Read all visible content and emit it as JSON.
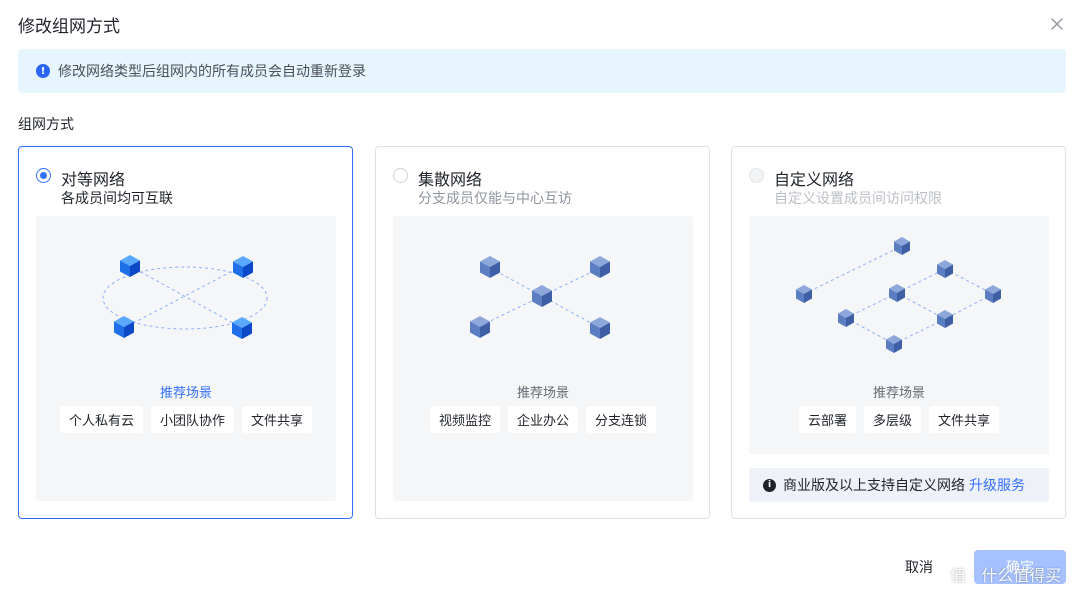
{
  "dialog": {
    "title": "修改组网方式"
  },
  "alert": {
    "text": "修改网络类型后组网内的所有成员会自动重新登录"
  },
  "section": {
    "label": "组网方式"
  },
  "cards": [
    {
      "title": "对等网络",
      "subtitle": "各成员间均可互联",
      "selected": true,
      "scene_label": "推荐场景",
      "tags": [
        "个人私有云",
        "小团队协作",
        "文件共享"
      ]
    },
    {
      "title": "集散网络",
      "subtitle": "分支成员仅能与中心互访",
      "selected": false,
      "scene_label": "推荐场景",
      "tags": [
        "视频监控",
        "企业办公",
        "分支连锁"
      ]
    },
    {
      "title": "自定义网络",
      "subtitle": "自定义设置成员间访问权限",
      "selected": false,
      "disabled": true,
      "scene_label": "推荐场景",
      "tags": [
        "云部署",
        "多层级",
        "文件共享"
      ],
      "notice": {
        "text": "商业版及以上支持自定义网络",
        "link": "升级服务"
      }
    }
  ],
  "footer": {
    "cancel_label": "取消",
    "confirm_label": "确定"
  },
  "watermark": "值 · 什么值得买",
  "colors": {
    "primary": "#3370ff",
    "alert_bg": "#e7f5fe",
    "panel_bg": "#f5f6f8",
    "confirm_disabled": "#a6c1ff",
    "node_bright": "#1e6cf5",
    "node_muted": "#5b7fc4"
  },
  "icons": {
    "close": "close-icon",
    "alert": "info-icon",
    "notice": "info-icon",
    "nodes": "cube-node-icon"
  }
}
